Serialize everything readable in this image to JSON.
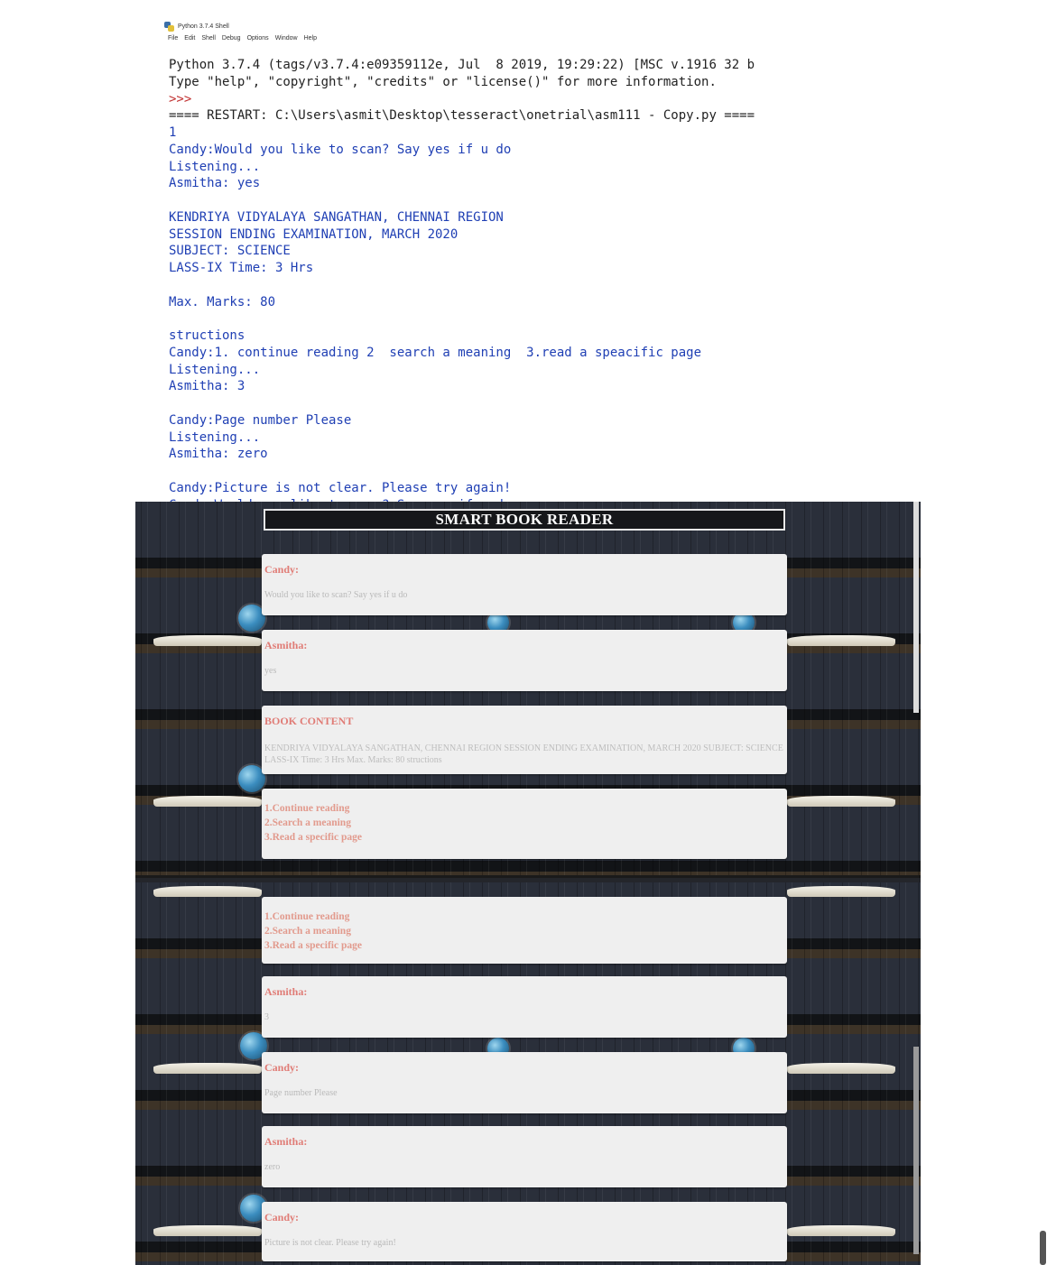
{
  "shell": {
    "window_title": "Python 3.7.4 Shell",
    "menu": [
      "File",
      "Edit",
      "Shell",
      "Debug",
      "Options",
      "Window",
      "Help"
    ],
    "lines": [
      {
        "text": "Python 3.7.4 (tags/v3.7.4:e09359112e, Jul  8 2019, 19:29:22) [MSC v.1916 32 b",
        "color": "black"
      },
      {
        "text": "Type \"help\", \"copyright\", \"credits\" or \"license()\" for more information.",
        "color": "black"
      },
      {
        "text": ">>>",
        "color": "red"
      },
      {
        "text": "==== RESTART: C:\\Users\\asmit\\Desktop\\tesseract\\onetrial\\asm111 - Copy.py ====",
        "color": "black"
      },
      {
        "text": "1",
        "color": "blue"
      },
      {
        "text": "Candy:Would you like to scan? Say yes if u do",
        "color": "blue"
      },
      {
        "text": "Listening...",
        "color": "blue"
      },
      {
        "text": "Asmitha: yes",
        "color": "blue"
      },
      {
        "text": "",
        "color": "blue"
      },
      {
        "text": "KENDRIYA VIDYALAYA SANGATHAN, CHENNAI REGION",
        "color": "blue"
      },
      {
        "text": "SESSION ENDING EXAMINATION, MARCH 2020",
        "color": "blue"
      },
      {
        "text": "SUBJECT: SCIENCE",
        "color": "blue"
      },
      {
        "text": "LASS-IX Time: 3 Hrs",
        "color": "blue"
      },
      {
        "text": "",
        "color": "blue"
      },
      {
        "text": "Max. Marks: 80",
        "color": "blue"
      },
      {
        "text": "",
        "color": "blue"
      },
      {
        "text": "structions",
        "color": "blue"
      },
      {
        "text": "Candy:1. continue reading 2  search a meaning  3.read a speacific page",
        "color": "blue"
      },
      {
        "text": "Listening...",
        "color": "blue"
      },
      {
        "text": "Asmitha: 3",
        "color": "blue"
      },
      {
        "text": "",
        "color": "blue"
      },
      {
        "text": "Candy:Page number Please",
        "color": "blue"
      },
      {
        "text": "Listening...",
        "color": "blue"
      },
      {
        "text": "Asmitha: zero",
        "color": "blue"
      },
      {
        "text": "",
        "color": "blue"
      },
      {
        "text": "Candy:Picture is not clear. Please try again!",
        "color": "blue"
      },
      {
        "text": "Candy:Would you like to scan? Say yes if u do",
        "color": "blue"
      }
    ]
  },
  "reader": {
    "title": "SMART BOOK READER",
    "panel1": [
      {
        "type": "chat",
        "name": "Candy:",
        "message": "Would you like to scan? Say yes if u do"
      },
      {
        "type": "chat",
        "name": "Asmitha:",
        "message": "yes"
      },
      {
        "type": "content",
        "name": "BOOK CONTENT",
        "message": "KENDRIYA VIDYALAYA SANGATHAN, CHENNAI REGION SESSION ENDING EXAMINATION, MARCH 2020 SUBJECT: SCIENCE LASS-IX Time: 3 Hrs Max. Marks: 80 structions"
      },
      {
        "type": "menu",
        "items": [
          "1.Continue reading",
          "2.Search a meaning",
          "3.Read a specific page"
        ]
      }
    ],
    "panel2": [
      {
        "type": "menu",
        "items": [
          "1.Continue reading",
          "2.Search a meaning",
          "3.Read a specific page"
        ]
      },
      {
        "type": "chat",
        "name": "Asmitha:",
        "message": "3"
      },
      {
        "type": "chat",
        "name": "Candy:",
        "message": "Page number Please"
      },
      {
        "type": "chat",
        "name": "Asmitha:",
        "message": "zero"
      },
      {
        "type": "chat",
        "name": "Candy:",
        "message": "Picture is not clear. Please try again!"
      }
    ]
  }
}
